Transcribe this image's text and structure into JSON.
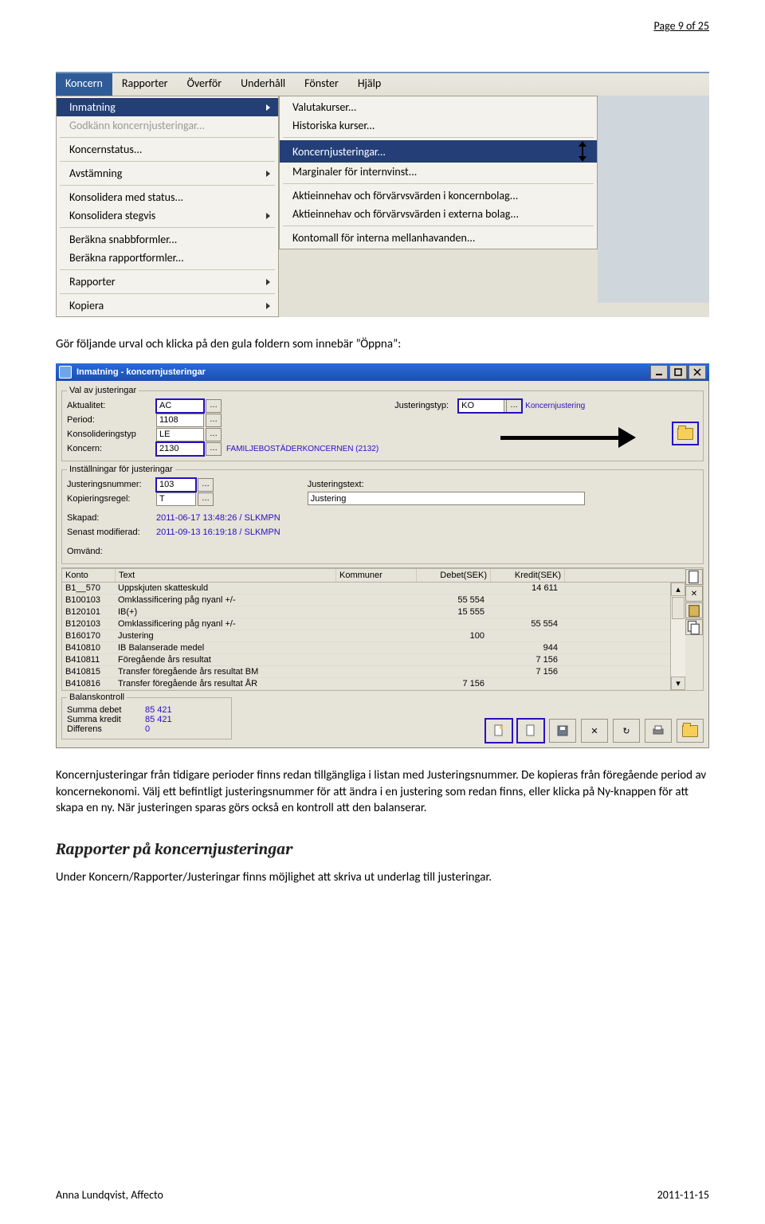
{
  "page": {
    "header": "Page 9 of 25",
    "footer_left": "Anna Lundqvist, Affecto",
    "footer_right": "2011-11-15"
  },
  "menubar": {
    "items": [
      "Koncern",
      "Rapporter",
      "Överför",
      "Underhåll",
      "Fönster",
      "Hjälp"
    ]
  },
  "menu1": {
    "items": [
      {
        "label": "Inmatning",
        "arrow": true,
        "selected": true
      },
      {
        "label": "Godkänn koncernjusteringar...",
        "disabled": true
      },
      {
        "label": "Koncernstatus..."
      },
      {
        "label": "Avstämning",
        "arrow": true
      },
      {
        "label": "Konsolidera med status..."
      },
      {
        "label": "Konsolidera stegvis",
        "arrow": true
      },
      {
        "label": "Beräkna snabbformler..."
      },
      {
        "label": "Beräkna rapportformler..."
      },
      {
        "label": "Rapporter",
        "arrow": true
      },
      {
        "label": "Kopiera",
        "arrow": true
      }
    ]
  },
  "menu2": {
    "items": [
      {
        "label": "Valutakurser..."
      },
      {
        "label": "Historiska kurser..."
      },
      {
        "label": "Koncernjusteringar...",
        "selected": true
      },
      {
        "label": "Marginaler för internvinst..."
      },
      {
        "label": "Aktieinnehav och förvärvsvärden i koncernbolag..."
      },
      {
        "label": "Aktieinnehav och förvärvsvärden i externa bolag..."
      },
      {
        "label": "Kontomall för interna mellanhavanden..."
      }
    ]
  },
  "para1": "Gör följande urval och klicka på den gula foldern som innebär ”Öppna”:",
  "dialog": {
    "title": "Inmatning - koncernjusteringar",
    "group1_legend": "Val av justeringar",
    "group2_legend": "Inställningar för justeringar",
    "labels": {
      "aktualitet": "Aktualitet:",
      "period": "Period:",
      "konsolideringstyp": "Konsolideringstyp",
      "koncern": "Koncern:",
      "justeringstyp": "Justeringstyp:",
      "justeringsnummer": "Justeringsnummer:",
      "kopieringsregel": "Kopieringsregel:",
      "justeringstext": "Justeringstext:",
      "skapad": "Skapad:",
      "senast": "Senast modifierad:",
      "omvand": "Omvänd:"
    },
    "values": {
      "aktualitet": "AC",
      "period": "1108",
      "konsolideringstyp": "LE",
      "koncern": "2130",
      "koncern_name": "FAMILJEBOSTÄDERKONCERNEN (2132)",
      "justeringstyp": "KO",
      "justeringstyp_txt": "Koncernjustering",
      "justeringsnummer": "103",
      "kopieringsregel": "T",
      "justeringstext": "Justering",
      "skapad": "2011-06-17 13:48:26 / SLKMPN",
      "senast": "2011-09-13 16:19:18 / SLKMPN"
    },
    "table": {
      "headers": {
        "c0": "Konto",
        "c1": "Text",
        "c2": "Kommuner",
        "c3": "Debet(SEK)",
        "c4": "Kredit(SEK)"
      },
      "rows": [
        {
          "c0": "B1__570",
          "c1": "Uppskjuten skatteskuld",
          "c2": "",
          "c3": "",
          "c4": "14 611"
        },
        {
          "c0": "B100103",
          "c1": "Omklassificering påg nyanl +/-",
          "c2": "",
          "c3": "55 554",
          "c4": ""
        },
        {
          "c0": "B120101",
          "c1": "IB(+)",
          "c2": "",
          "c3": "15 555",
          "c4": ""
        },
        {
          "c0": "B120103",
          "c1": "Omklassificering påg nyanl +/-",
          "c2": "",
          "c3": "",
          "c4": "55 554"
        },
        {
          "c0": "B160170",
          "c1": "Justering",
          "c2": "",
          "c3": "100",
          "c4": ""
        },
        {
          "c0": "B410810",
          "c1": "IB Balanserade medel",
          "c2": "",
          "c3": "",
          "c4": "944"
        },
        {
          "c0": "B410811",
          "c1": "Föregående års resultat",
          "c2": "",
          "c3": "",
          "c4": "7 156"
        },
        {
          "c0": "B410815",
          "c1": "Transfer föregående års resultat BM",
          "c2": "",
          "c3": "",
          "c4": "7 156"
        },
        {
          "c0": "B410816",
          "c1": "Transfer föregående års resultat ÅR",
          "c2": "",
          "c3": "7 156",
          "c4": ""
        }
      ]
    },
    "balance": {
      "legend": "Balanskontroll",
      "debet_k": "Summa debet",
      "debet_v": "85 421",
      "kredit_k": "Summa kredit",
      "kredit_v": "85 421",
      "diff_k": "Differens",
      "diff_v": "0"
    }
  },
  "para2": "Koncernjusteringar från tidigare perioder finns redan tillgängliga i listan med Justeringsnummer. De kopieras från föregående period av koncernekonomi. Välj ett befintligt justeringsnummer för att ändra i en justering som redan finns, eller klicka på Ny-knappen för att skapa en ny. När justeringen sparas görs också en kontroll att den balanserar.",
  "heading": "Rapporter på koncernjusteringar",
  "para3": "Under Koncern/Rapporter/Justeringar finns möjlighet att skriva ut underlag till justeringar."
}
